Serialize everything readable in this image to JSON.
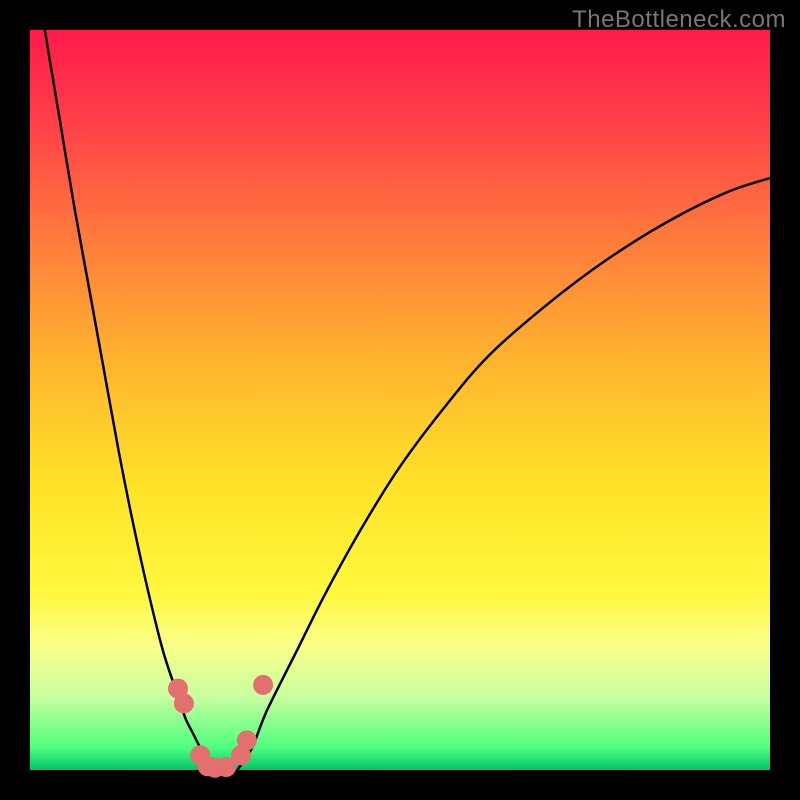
{
  "watermark": "TheBottleneck.com",
  "frame": {
    "outer_width": 800,
    "outer_height": 800,
    "inner_x": 30,
    "inner_y": 30,
    "inner_width": 740,
    "inner_height": 740,
    "frame_color": "#000000"
  },
  "gradient": {
    "stops": [
      {
        "offset": 0.0,
        "color": "#ff1a4b"
      },
      {
        "offset": 0.12,
        "color": "#ff3e49"
      },
      {
        "offset": 0.28,
        "color": "#ff7a3c"
      },
      {
        "offset": 0.45,
        "color": "#ffb52e"
      },
      {
        "offset": 0.62,
        "color": "#ffe428"
      },
      {
        "offset": 0.76,
        "color": "#fff83e"
      },
      {
        "offset": 0.83,
        "color": "#f9ff87"
      },
      {
        "offset": 0.9,
        "color": "#c9ffa0"
      },
      {
        "offset": 0.97,
        "color": "#4dff7d"
      },
      {
        "offset": 1.0,
        "color": "#00c46a"
      }
    ]
  },
  "chart_data": {
    "type": "line",
    "title": "",
    "xlabel": "",
    "ylabel": "",
    "xlim": [
      0,
      100
    ],
    "ylim": [
      0,
      100
    ],
    "series": [
      {
        "name": "curve-left",
        "x": [
          2,
          4,
          6,
          8,
          10,
          12,
          14,
          16,
          18,
          20,
          21,
          22,
          23,
          24,
          25
        ],
        "values": [
          100,
          88,
          76,
          65,
          54,
          43,
          33,
          24,
          16,
          10,
          7,
          5,
          3,
          1,
          0
        ]
      },
      {
        "name": "curve-right",
        "x": [
          28,
          30,
          32,
          36,
          40,
          45,
          50,
          56,
          62,
          70,
          78,
          86,
          94,
          100
        ],
        "values": [
          0,
          3,
          8,
          16,
          24,
          33,
          41,
          49,
          56,
          63,
          69,
          74,
          78,
          80
        ]
      }
    ],
    "markers": [
      {
        "x": 20.0,
        "y": 11.0
      },
      {
        "x": 20.8,
        "y": 9.0
      },
      {
        "x": 23.0,
        "y": 2.0
      },
      {
        "x": 24.0,
        "y": 0.5
      },
      {
        "x": 25.0,
        "y": 0.3
      },
      {
        "x": 26.5,
        "y": 0.4
      },
      {
        "x": 28.5,
        "y": 2.0
      },
      {
        "x": 29.3,
        "y": 4.0
      },
      {
        "x": 31.5,
        "y": 11.5
      }
    ],
    "marker_color": "#e36f6f",
    "marker_radius": 10,
    "curve_color": "#000000",
    "curve_width": 2.5
  }
}
